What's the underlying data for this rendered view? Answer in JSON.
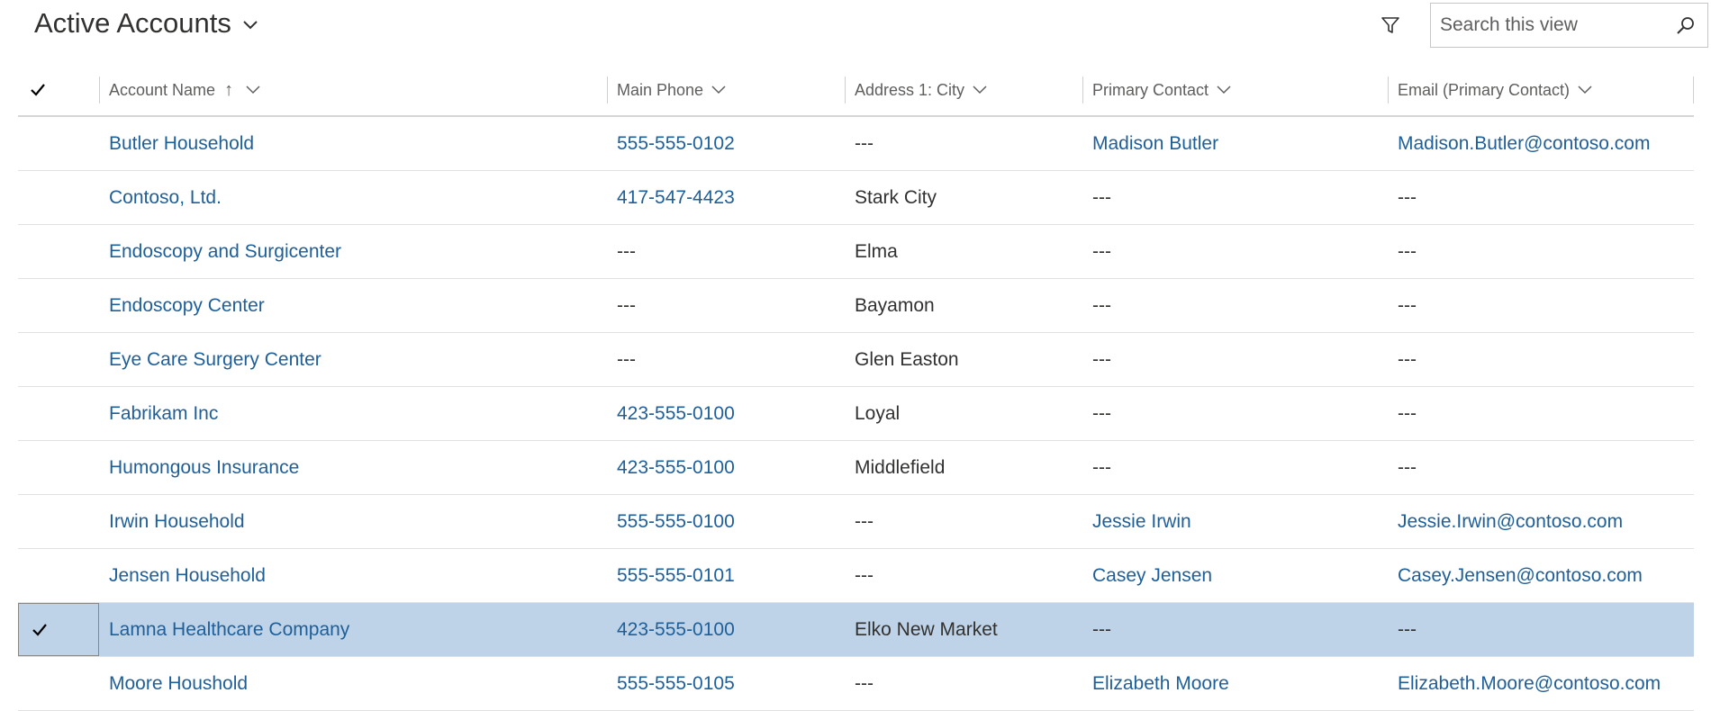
{
  "view": {
    "title": "Active Accounts"
  },
  "search": {
    "placeholder": "Search this view"
  },
  "columns": [
    {
      "label": "Account Name",
      "sorted": "ascending"
    },
    {
      "label": "Main Phone"
    },
    {
      "label": "Address 1: City"
    },
    {
      "label": "Primary Contact"
    },
    {
      "label": "Email (Primary Contact)"
    }
  ],
  "rows": [
    {
      "name": "Butler Household",
      "phone": "555-555-0102",
      "city": "---",
      "contact": "Madison Butler",
      "email": "Madison.Butler@contoso.com",
      "selected": false
    },
    {
      "name": "Contoso, Ltd.",
      "phone": "417-547-4423",
      "city": "Stark City",
      "contact": "---",
      "email": "---",
      "selected": false
    },
    {
      "name": "Endoscopy and Surgicenter",
      "phone": "---",
      "city": "Elma",
      "contact": "---",
      "email": "---",
      "selected": false
    },
    {
      "name": "Endoscopy Center",
      "phone": "---",
      "city": "Bayamon",
      "contact": "---",
      "email": "---",
      "selected": false
    },
    {
      "name": "Eye Care Surgery Center",
      "phone": "---",
      "city": "Glen Easton",
      "contact": "---",
      "email": "---",
      "selected": false
    },
    {
      "name": "Fabrikam Inc",
      "phone": "423-555-0100",
      "city": "Loyal",
      "contact": "---",
      "email": "---",
      "selected": false
    },
    {
      "name": "Humongous Insurance",
      "phone": "423-555-0100",
      "city": "Middlefield",
      "contact": "---",
      "email": "---",
      "selected": false
    },
    {
      "name": "Irwin Household",
      "phone": "555-555-0100",
      "city": "---",
      "contact": "Jessie Irwin",
      "email": "Jessie.Irwin@contoso.com",
      "selected": false
    },
    {
      "name": "Jensen Household",
      "phone": "555-555-0101",
      "city": "---",
      "contact": "Casey Jensen",
      "email": "Casey.Jensen@contoso.com",
      "selected": false
    },
    {
      "name": "Lamna Healthcare Company",
      "phone": "423-555-0100",
      "city": "Elko New Market",
      "contact": "---",
      "email": "---",
      "selected": true
    },
    {
      "name": "Moore Houshold",
      "phone": "555-555-0105",
      "city": "---",
      "contact": "Elizabeth Moore",
      "email": "Elizabeth.Moore@contoso.com",
      "selected": false
    }
  ],
  "colors": {
    "link": "#1f5f99",
    "selected_row": "#bed3e8"
  }
}
